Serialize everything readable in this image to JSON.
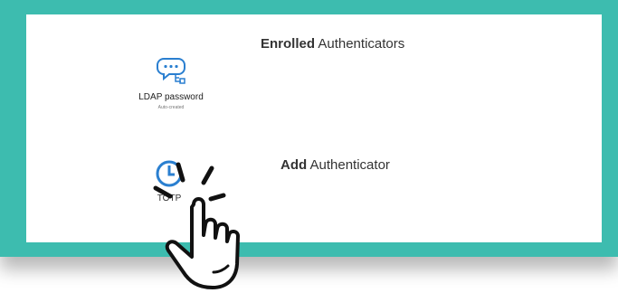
{
  "colors": {
    "frame": "#3dbcaf",
    "panel": "#ffffff",
    "accent_icon": "#2a7fd0"
  },
  "enrolled": {
    "title_bold": "Enrolled",
    "title_rest": " Authenticators",
    "items": [
      {
        "icon": "password-chat-icon",
        "label": "LDAP password",
        "sublabel": "Auto-created"
      }
    ]
  },
  "add": {
    "title_bold": "Add",
    "title_rest": " Authenticator",
    "items": [
      {
        "icon": "clock-icon",
        "label": "TOTP"
      }
    ]
  },
  "overlay": {
    "icon": "pointing-hand-click-icon"
  }
}
